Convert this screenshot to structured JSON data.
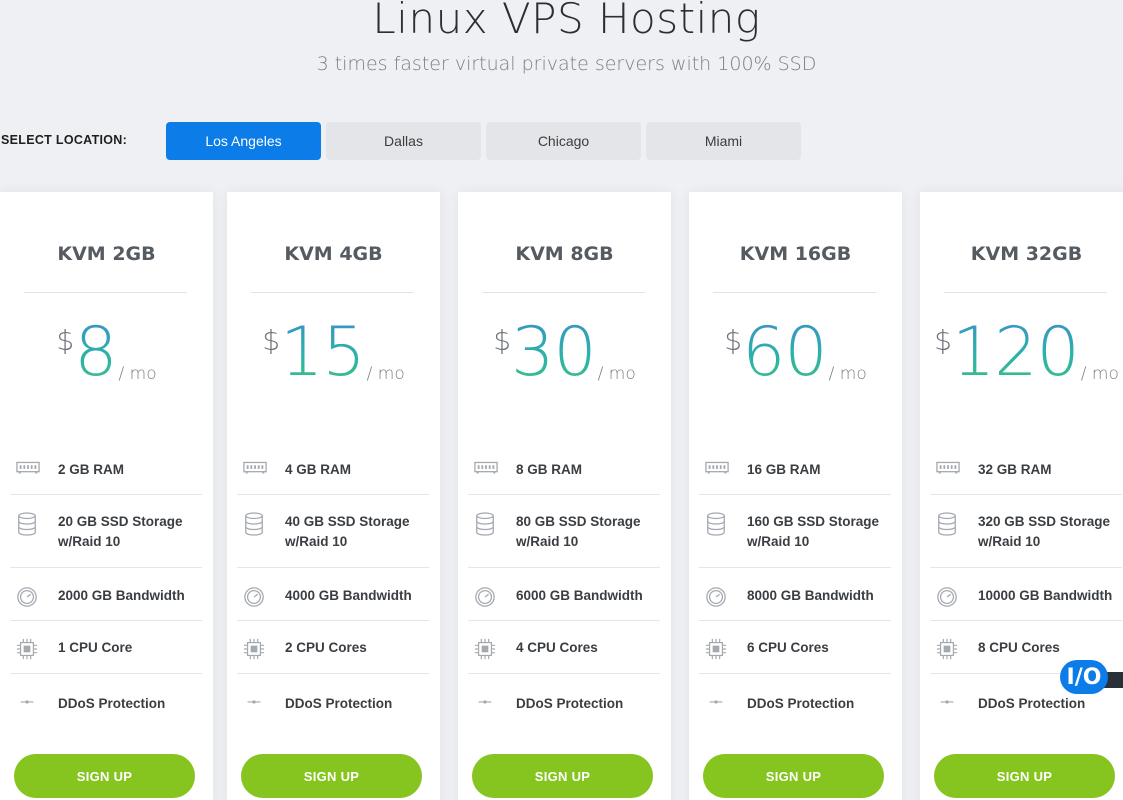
{
  "header": {
    "title": "Linux VPS Hosting",
    "subtitle": "3 times faster virtual private servers with 100% SSD"
  },
  "location": {
    "label": "SELECT LOCATION:",
    "options": [
      "Los Angeles",
      "Dallas",
      "Chicago",
      "Miami"
    ],
    "selected": "Los Angeles"
  },
  "plans": [
    {
      "name": "KVM 2GB",
      "currency": "$",
      "price": "8",
      "period": "/ mo",
      "features": [
        "2 GB RAM",
        "20 GB SSD Storage w/Raid 10",
        "2000 GB Bandwidth",
        "1 CPU Core",
        "DDoS Protection"
      ],
      "cta": "SIGN UP"
    },
    {
      "name": "KVM 4GB",
      "currency": "$",
      "price": "15",
      "period": "/ mo",
      "features": [
        "4 GB RAM",
        "40 GB SSD Storage w/Raid 10",
        "4000 GB Bandwidth",
        "2 CPU Cores",
        "DDoS Protection"
      ],
      "cta": "SIGN UP"
    },
    {
      "name": "KVM 8GB",
      "currency": "$",
      "price": "30",
      "period": "/ mo",
      "features": [
        "8 GB RAM",
        "80 GB SSD Storage w/Raid 10",
        "6000 GB Bandwidth",
        "4 CPU Cores",
        "DDoS Protection"
      ],
      "cta": "SIGN UP"
    },
    {
      "name": "KVM 16GB",
      "currency": "$",
      "price": "60",
      "period": "/ mo",
      "features": [
        "16 GB RAM",
        "160 GB SSD Storage w/Raid 10",
        "8000 GB Bandwidth",
        "6 CPU Cores",
        "DDoS Protection"
      ],
      "cta": "SIGN UP"
    },
    {
      "name": "KVM 32GB",
      "currency": "$",
      "price": "120",
      "period": "/ mo",
      "features": [
        "32 GB RAM",
        "320 GB SSD Storage w/Raid 10",
        "10000 GB Bandwidth",
        "8 CPU Cores",
        "DDoS Protection"
      ],
      "cta": "SIGN UP"
    }
  ],
  "feature_icons": [
    "memory-icon",
    "database-icon",
    "gauge-icon",
    "cpu-icon",
    "shield-icon"
  ],
  "chat_badge": {
    "text": "I/O"
  },
  "colors": {
    "accent": "#0b7ce8",
    "signup": "#86c41f",
    "price": "#2ba7a7"
  }
}
